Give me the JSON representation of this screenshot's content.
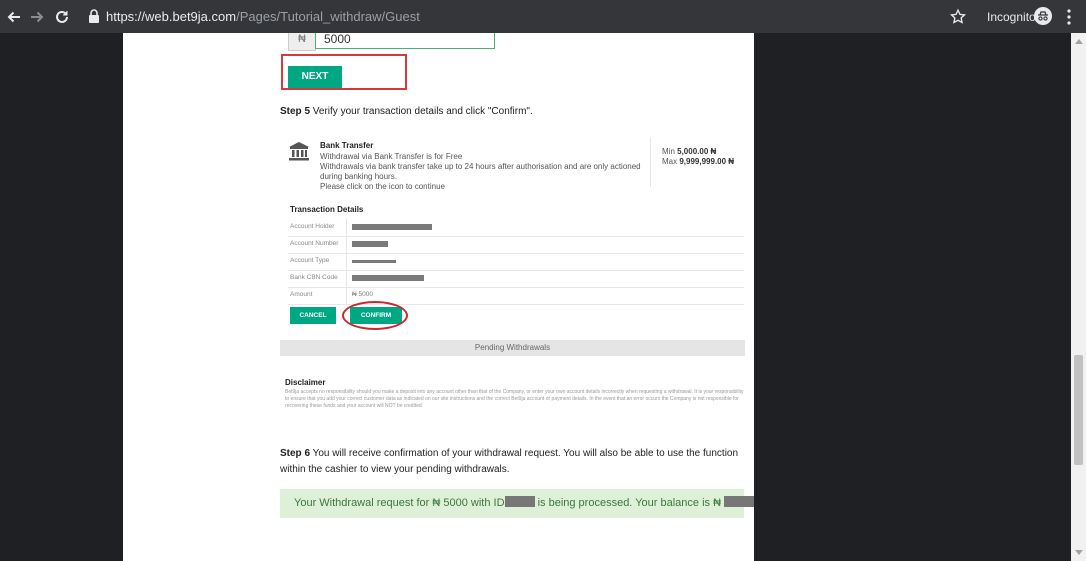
{
  "browser": {
    "url_host": "https://web.bet9ja.com",
    "url_path": "/Pages/Tutorial_withdraw/Guest",
    "incognito_label": "Incognito"
  },
  "amount_field": {
    "prefix": "₦",
    "value": "5000"
  },
  "next_button": "NEXT",
  "step5": {
    "label": "Step 5",
    "text": " Verify your transaction details and click \"Confirm\"."
  },
  "bank": {
    "title": "Bank Transfer",
    "lines": [
      "Withdrawal via Bank Transfer is for Free",
      "Withdrawals via bank transfer take up to 24 hours after authorisation and are only actioned",
      "during banking hours.",
      "Please click on the icon to continue"
    ],
    "min_label": "Min",
    "min_value": "5,000.00 ₦",
    "max_label": "Max",
    "max_value": "9,999,999.00 ₦"
  },
  "transaction_details": {
    "title": "Transaction Details",
    "rows": [
      {
        "label": "Account Holder",
        "redacted_width": 80
      },
      {
        "label": "Account Number",
        "redacted_width": 36
      },
      {
        "label": "Account Type",
        "redacted_width": 44
      },
      {
        "label": "Bank CBN Code",
        "redacted_width": 72
      },
      {
        "label": "Amount",
        "value": "₦ 5000"
      }
    ]
  },
  "buttons": {
    "cancel": "CANCEL",
    "confirm": "CONFIRM"
  },
  "pending_withdrawals": "Pending Withdrawals",
  "disclaimer": {
    "title": "Disclaimer",
    "text": "Bet9ja accepts no responsibility should you make a deposit into any account other than that of the Company, or enter your own account details incorrectly when requesting a withdrawal. It is your responsibility to ensure that you add your correct customer data as indicated on our site instructions and the correct Bet9ja account or payment details. In the event that an error occurs the Company is not responsible for recovering these funds and your account will NOT be credited."
  },
  "step6": {
    "label": "Step 6",
    "line1": " You will receive confirmation of your withdrawal request. You will also be able to use the function",
    "line2": "within the cashier to view your pending withdrawals."
  },
  "success": {
    "part1": "Your Withdrawal request for ₦ 5000 with ID",
    "part2": " is being processed. Your balance is ₦ "
  },
  "colors": {
    "brand_green": "#00a783",
    "highlight_red": "#d23b3b",
    "success_bg": "#dff0d8",
    "success_text": "#3c763d"
  }
}
